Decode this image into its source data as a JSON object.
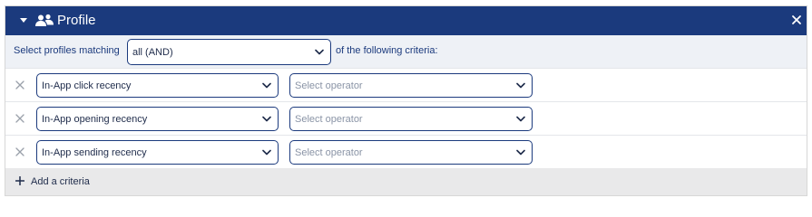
{
  "panel": {
    "title": "Profile",
    "header_icon": "users-icon",
    "close_icon": "close-icon",
    "colors": {
      "header_bg": "#1b3a7d",
      "match_row_bg": "#eef1f6",
      "add_row_bg": "#e9e9ea",
      "accent": "#1b3a7d"
    }
  },
  "match": {
    "label": "Select profiles matching",
    "selected": "all (AND)",
    "suffix": "of the following criteria:"
  },
  "criteria": [
    {
      "field": "In-App click recency",
      "operator_placeholder": "Select operator"
    },
    {
      "field": "In-App opening recency",
      "operator_placeholder": "Select operator"
    },
    {
      "field": "In-App sending recency",
      "operator_placeholder": "Select operator"
    }
  ],
  "add_criteria": {
    "label": "Add a criteria",
    "icon": "plus-icon"
  }
}
